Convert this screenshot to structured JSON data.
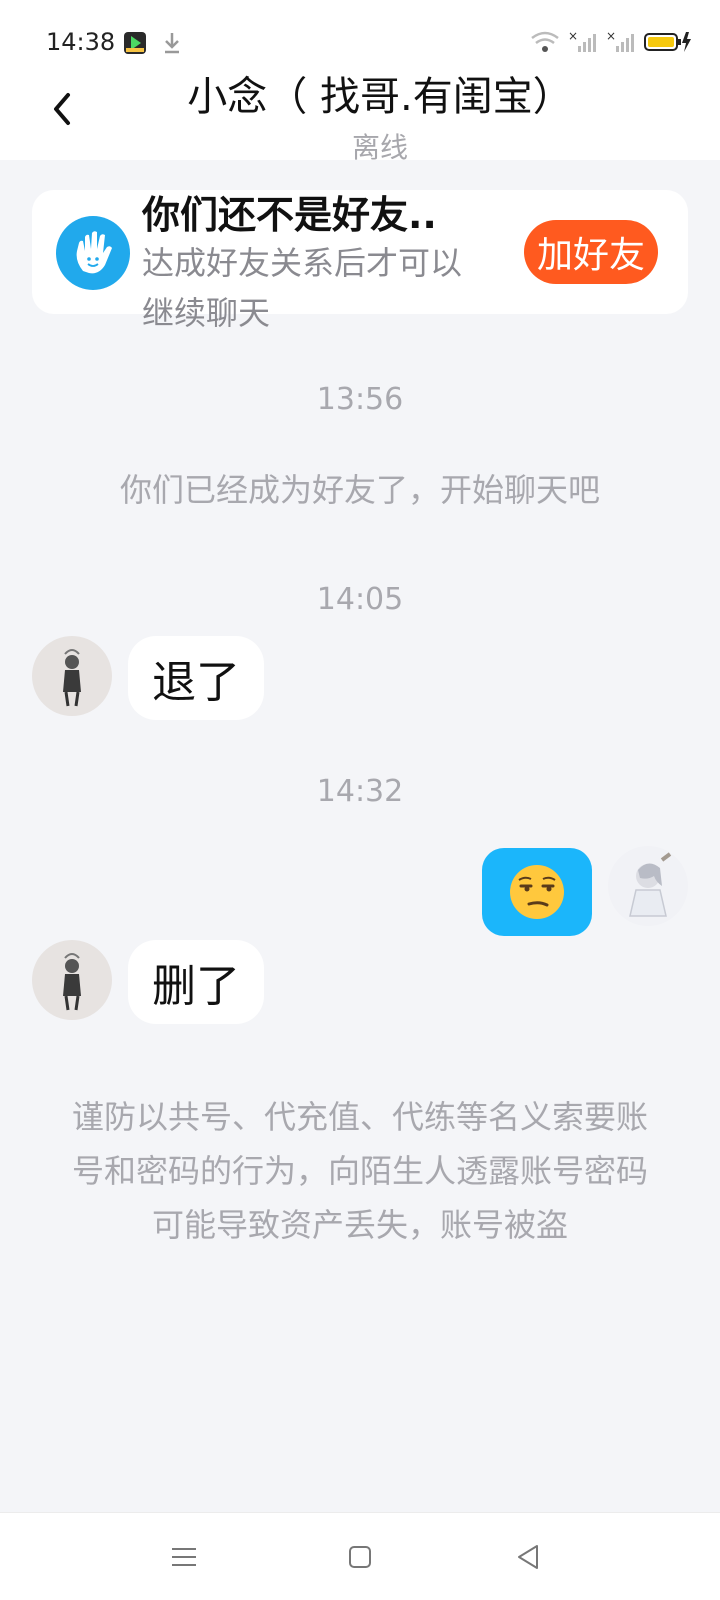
{
  "status_bar": {
    "time": "14:38",
    "icons": [
      "video-app-icon",
      "download-icon",
      "wifi-icon",
      "signal-icon",
      "signal-icon",
      "battery-charging-icon"
    ]
  },
  "header": {
    "title": "小念（ 找哥.有闺宝）",
    "status": "离线",
    "back_icon": "chevron-left-icon"
  },
  "friend_banner": {
    "title": "你们还不是好友..",
    "description": "达成好友关系后才可以继续聊天",
    "button_label": "加好友",
    "button_color": "#ff5a1f"
  },
  "chat": {
    "timestamps": [
      "13:56",
      "14:05",
      "14:32"
    ],
    "system_message": "你们已经成为好友了，开始聊天吧",
    "messages": [
      {
        "side": "left",
        "text": "退了"
      },
      {
        "side": "right",
        "emoji": "😒"
      },
      {
        "side": "left",
        "text": "删了"
      }
    ],
    "warning": "谨防以共号、代充值、代练等名义索要账号和密码的行为，向陌生人透露账号密码可能导致资产丢失，账号被盗"
  },
  "colors": {
    "accent_blue": "#1bb6fb",
    "background": "#f4f5f8"
  },
  "nav_bar": {
    "icons": [
      "menu-icon",
      "home-square-icon",
      "back-triangle-icon"
    ]
  }
}
